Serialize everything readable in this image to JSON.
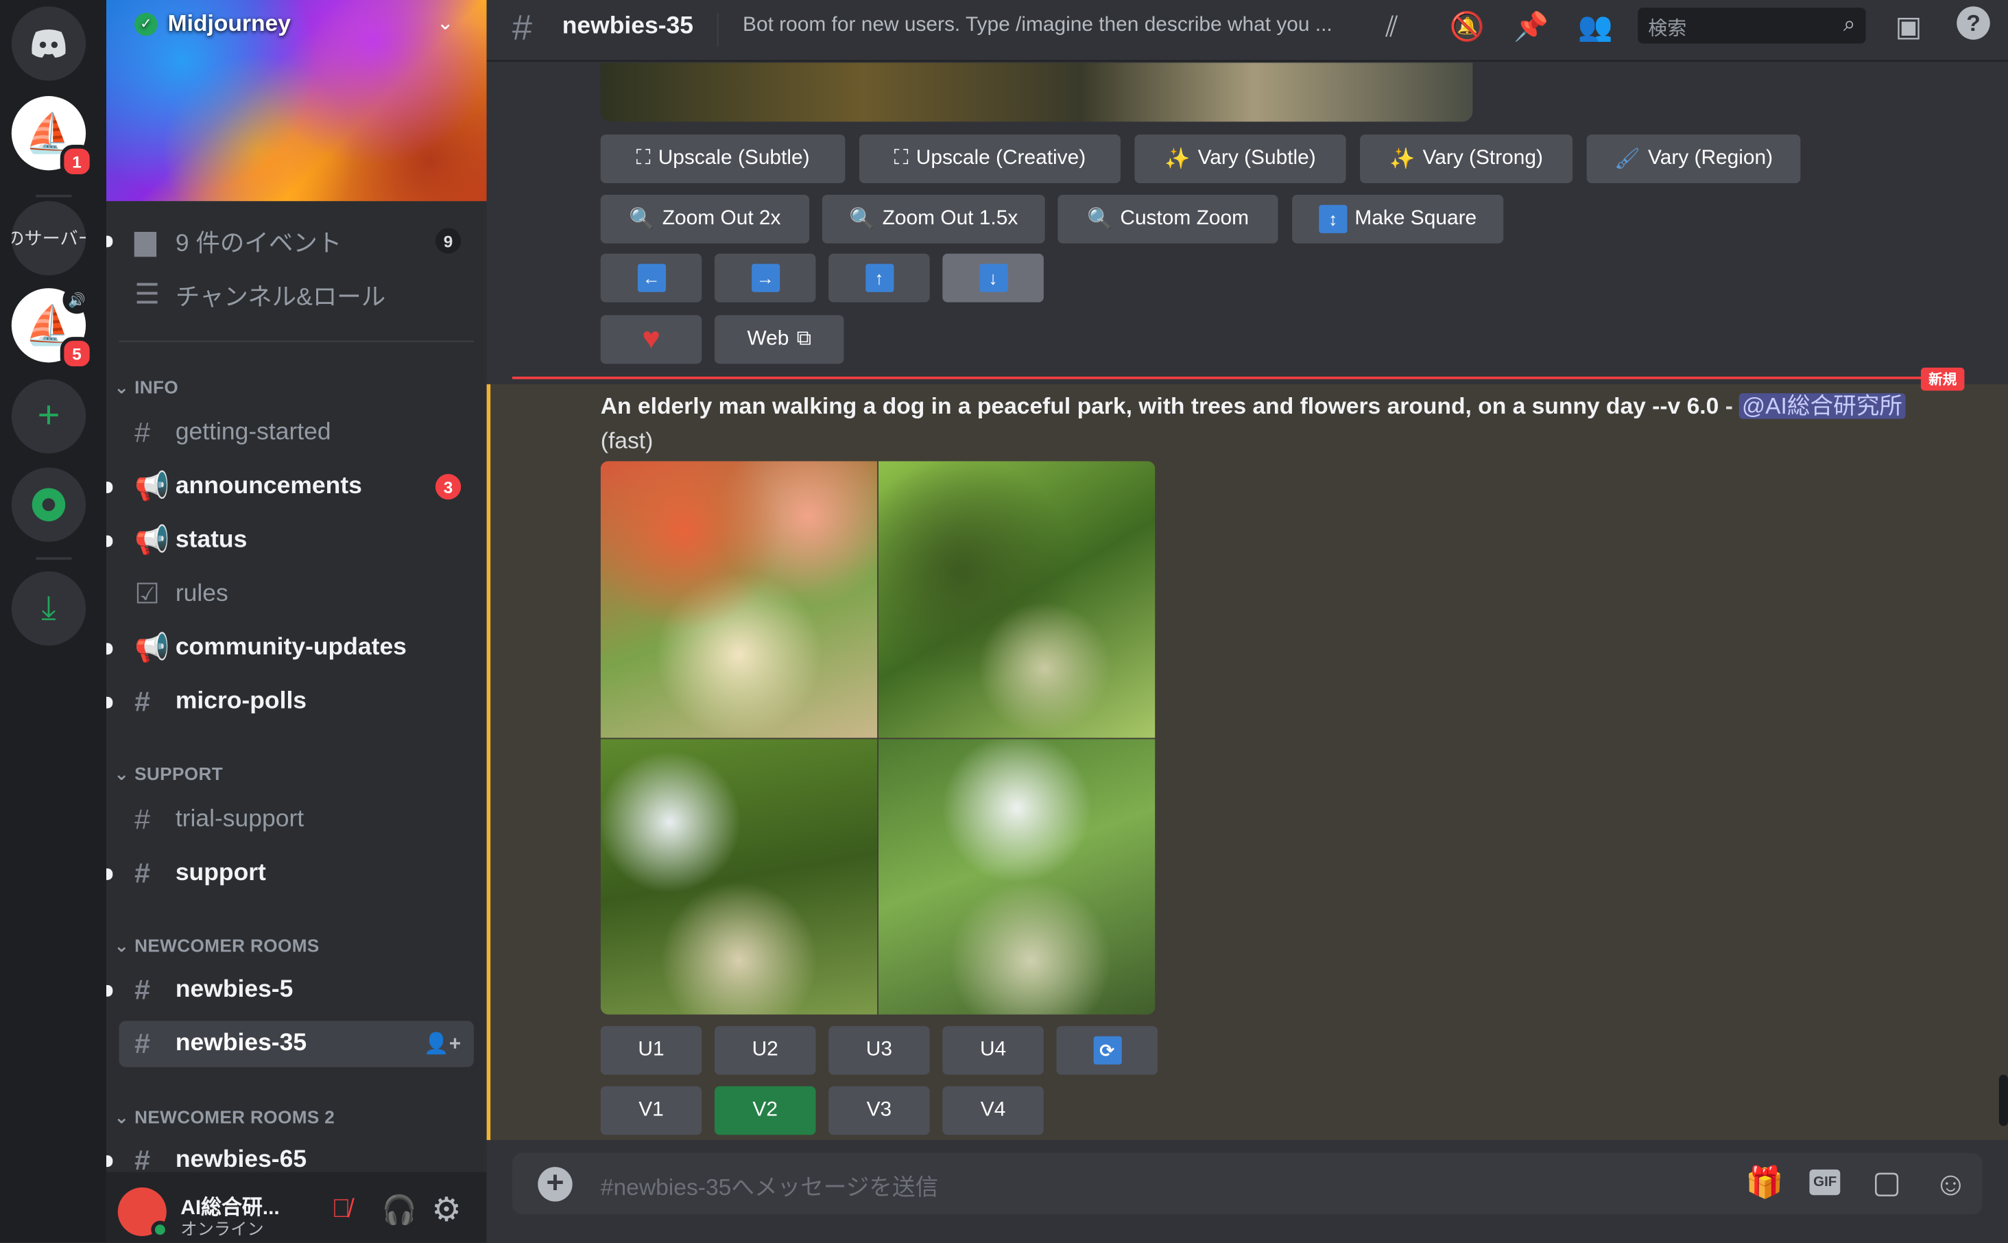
{
  "servers": {
    "my_servers_label": "のサーバー",
    "badge_midjourney_1": "1",
    "badge_midjourney_2": "5"
  },
  "server": {
    "name": "Midjourney"
  },
  "sidebar": {
    "events": {
      "label": "9 件のイベント",
      "count": "9"
    },
    "channels_roles": "チャンネル&ロール",
    "categories": [
      "INFO",
      "SUPPORT",
      "NEWCOMER ROOMS",
      "NEWCOMER ROOMS 2"
    ],
    "channels": [
      {
        "label": "getting-started"
      },
      {
        "label": "announcements",
        "count": "3"
      },
      {
        "label": "status"
      },
      {
        "label": "rules"
      },
      {
        "label": "community-updates"
      },
      {
        "label": "micro-polls"
      },
      {
        "label": "trial-support"
      },
      {
        "label": "support"
      },
      {
        "label": "newbies-5"
      },
      {
        "label": "newbies-35"
      },
      {
        "label": "newbies-65"
      }
    ]
  },
  "user": {
    "name": "AI総合研...",
    "status": "オンライン"
  },
  "header": {
    "channel": "newbies-35",
    "topic": "Bot room for new users. Type /imagine then describe what you ...",
    "search_placeholder": "検索"
  },
  "previous_message": {
    "buttons_row1": [
      "Upscale (Subtle)",
      "Upscale (Creative)",
      "Vary (Subtle)",
      "Vary (Strong)",
      "Vary (Region)"
    ],
    "buttons_row2": [
      "Zoom Out 2x",
      "Zoom Out 1.5x",
      "Custom Zoom",
      "Make Square"
    ],
    "arrows": [
      "←",
      "→",
      "↑",
      "↓"
    ],
    "web_label": "Web"
  },
  "new_divider": "新規",
  "message": {
    "prompt": "An elderly man walking a dog in a peaceful park, with trees and flowers around, on a sunny day --v 6.0",
    "dash": "-",
    "mention": "@AI総合研究所",
    "mode": "(fast)",
    "upscale_buttons": [
      "U1",
      "U2",
      "U3",
      "U4"
    ],
    "variation_buttons": [
      "V1",
      "V2",
      "V3",
      "V4"
    ],
    "selected_variation": "V2"
  },
  "composer": {
    "placeholder": "#newbies-35へメッセージを送信",
    "gif_label": "GIF"
  },
  "colors": {
    "accent_green": "#248046",
    "mention_highlight": "#f0b232",
    "unread_red": "#f23f43",
    "arrow_blue": "#3b82d6"
  }
}
